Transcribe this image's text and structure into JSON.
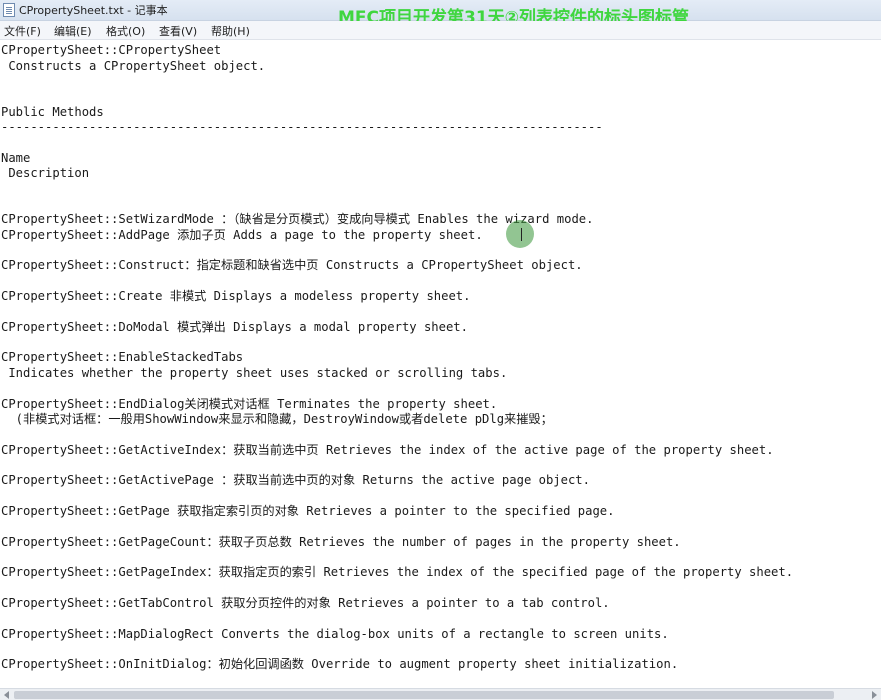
{
  "window": {
    "title": "CPropertySheet.txt - 记事本",
    "overlay_caption": "MFC项目开发第31天②列表控件的标头图标管"
  },
  "menu": {
    "file": "文件(F)",
    "edit": "编辑(E)",
    "format": "格式(O)",
    "view": "查看(V)",
    "help": "帮助(H)"
  },
  "document": {
    "lines": [
      "CPropertySheet::CPropertySheet",
      " Constructs a CPropertySheet object.",
      "Public Methods",
      "----------------------------------------------------------------------------------",
      "Name",
      " Description",
      "CPropertySheet::SetWizardMode ：（缺省是分页模式）变成向导模式 Enables the wizard mode.",
      "CPropertySheet::AddPage 添加子页 Adds a page to the property sheet.",
      "CPropertySheet::Construct：指定标题和缺省选中页 Constructs a CPropertySheet object.",
      "CPropertySheet::Create 非模式 Displays a modeless property sheet.",
      "CPropertySheet::DoModal 模式弹出 Displays a modal property sheet.",
      "CPropertySheet::EnableStackedTabs",
      " Indicates whether the property sheet uses stacked or scrolling tabs.",
      "CPropertySheet::EndDialog关闭模式对话框 Terminates the property sheet.",
      "  (非模式对话框：一般用ShowWindow来显示和隐藏，DestroyWindow或者delete pDlg来摧毁；",
      "CPropertySheet::GetActiveIndex：获取当前选中页 Retrieves the index of the active page of the property sheet.",
      "CPropertySheet::GetActivePage ：获取当前选中页的对象 Returns the active page object.",
      "CPropertySheet::GetPage 获取指定索引页的对象 Retrieves a pointer to the specified page.",
      "CPropertySheet::GetPageCount：获取子页总数 Retrieves the number of pages in the property sheet.",
      "CPropertySheet::GetPageIndex：获取指定页的索引 Retrieves the index of the specified page of the property sheet.",
      "CPropertySheet::GetTabControl 获取分页控件的对象 Retrieves a pointer to a tab control.",
      "CPropertySheet::MapDialogRect Converts the dialog-box units of a rectangle to screen units.",
      "CPropertySheet::OnInitDialog：初始化回调函数 Override to augment property sheet initialization."
    ]
  }
}
